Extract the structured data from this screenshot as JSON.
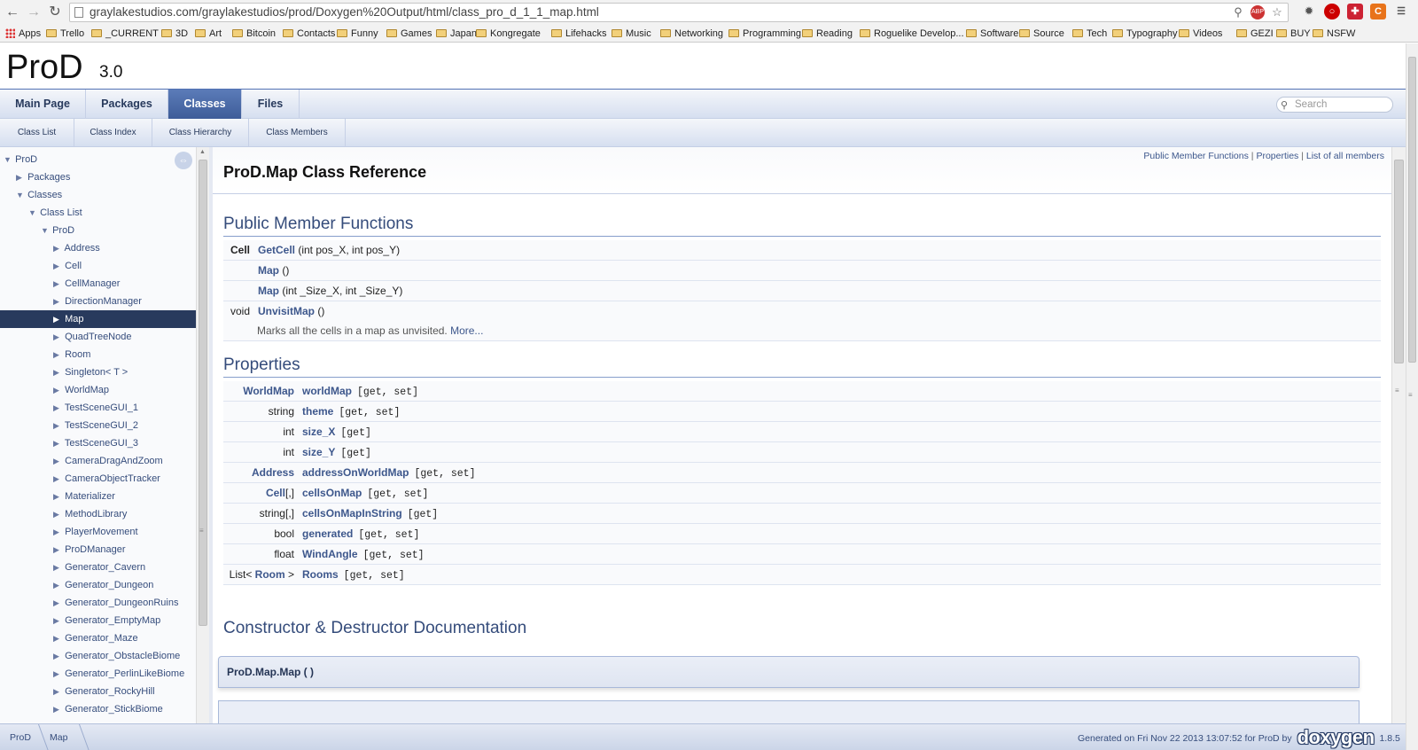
{
  "browser": {
    "url": "graylakestudios.com/graylakestudios/prod/Doxygen%20Output/html/class_pro_d_1_1_map.html",
    "back_icon": "arrow-left-icon",
    "forward_icon": "arrow-right-icon",
    "reload_icon": "reload-icon",
    "ext_adblock_label": "ABP",
    "ext_c_label": "C",
    "bookmarks": [
      "Apps",
      "Trello",
      "_CURRENT",
      "3D",
      "Art",
      "Bitcoin",
      "Contacts",
      "Funny",
      "Games",
      "Japan",
      "Kongregate",
      "Lifehacks",
      "Music",
      "Networking",
      "Programming",
      "Reading",
      "Roguelike Develop...",
      "Software",
      "Source",
      "Tech",
      "Typography",
      "Videos",
      "GEZI",
      "BUY",
      "NSFW"
    ]
  },
  "project": {
    "name": "ProD",
    "number": "3.0"
  },
  "tabs": [
    "Main Page",
    "Packages",
    "Classes",
    "Files"
  ],
  "active_tab": "Classes",
  "search_placeholder": "Search",
  "subtabs": [
    "Class List",
    "Class Index",
    "Class Hierarchy",
    "Class Members"
  ],
  "sidenav": {
    "root": "ProD",
    "packages": "Packages",
    "classes": "Classes",
    "class_list": "Class List",
    "namespace": "ProD",
    "items": [
      "Address",
      "Cell",
      "CellManager",
      "DirectionManager",
      "Map",
      "QuadTreeNode",
      "Room",
      "Singleton< T >",
      "WorldMap",
      "TestSceneGUI_1",
      "TestSceneGUI_2",
      "TestSceneGUI_3",
      "CameraDragAndZoom",
      "CameraObjectTracker",
      "Materializer",
      "MethodLibrary",
      "PlayerMovement",
      "ProDManager",
      "Generator_Cavern",
      "Generator_Dungeon",
      "Generator_DungeonRuins",
      "Generator_EmptyMap",
      "Generator_Maze",
      "Generator_ObstacleBiome",
      "Generator_PerlinLikeBiome",
      "Generator_RockyHill",
      "Generator_StickBiome"
    ],
    "selected": "Map"
  },
  "summary_links": [
    "Public Member Functions",
    "Properties",
    "List of all members"
  ],
  "summary_sep": "|",
  "class_title": "ProD.Map Class Reference",
  "public_functions": {
    "header": "Public Member Functions",
    "rows": [
      {
        "type": "Cell",
        "name": "GetCell",
        "args": " (int pos_X, int pos_Y)"
      },
      {
        "type": "",
        "name": "Map",
        "args": " ()"
      },
      {
        "type": "",
        "name": "Map",
        "args": " (int _Size_X, int _Size_Y)"
      },
      {
        "type": "void",
        "name": "UnvisitMap",
        "args": " ()",
        "desc": "Marks all the cells in a map as unvisited. ",
        "more": "More..."
      }
    ]
  },
  "properties": {
    "header": "Properties",
    "rows": [
      {
        "type_link": "WorldMap",
        "type_prefix": "",
        "type_suffix": "",
        "name": "worldMap",
        "access": "[get, set]"
      },
      {
        "type_link": "",
        "type_prefix": "string",
        "type_suffix": "",
        "name": "theme",
        "access": "[get, set]"
      },
      {
        "type_link": "",
        "type_prefix": "int",
        "type_suffix": "",
        "name": "size_X",
        "access": "[get]"
      },
      {
        "type_link": "",
        "type_prefix": "int",
        "type_suffix": "",
        "name": "size_Y",
        "access": "[get]"
      },
      {
        "type_link": "Address",
        "type_prefix": "",
        "type_suffix": "",
        "name": "addressOnWorldMap",
        "access": "[get, set]"
      },
      {
        "type_link": "Cell",
        "type_prefix": "",
        "type_suffix": "[,]",
        "name": "cellsOnMap",
        "access": "[get, set]"
      },
      {
        "type_link": "",
        "type_prefix": "string[,]",
        "type_suffix": "",
        "name": "cellsOnMapInString",
        "access": "[get]"
      },
      {
        "type_link": "",
        "type_prefix": "bool",
        "type_suffix": "",
        "name": "generated",
        "access": "[get, set]"
      },
      {
        "type_link": "",
        "type_prefix": "float",
        "type_suffix": "",
        "name": "WindAngle",
        "access": "[get, set]"
      },
      {
        "type_link": "Room",
        "type_prefix": "List< ",
        "type_suffix": " >",
        "name": "Rooms",
        "access": "[get, set]"
      }
    ]
  },
  "ctor_header": "Constructor & Destructor Documentation",
  "ctor_proto": "ProD.Map.Map ( )",
  "navpath": [
    "ProD",
    "Map"
  ],
  "footer": {
    "generated": "Generated on Fri Nov 22 2013 13:07:52 for ProD by",
    "logo": "doxygen",
    "version": "1.8.5"
  }
}
